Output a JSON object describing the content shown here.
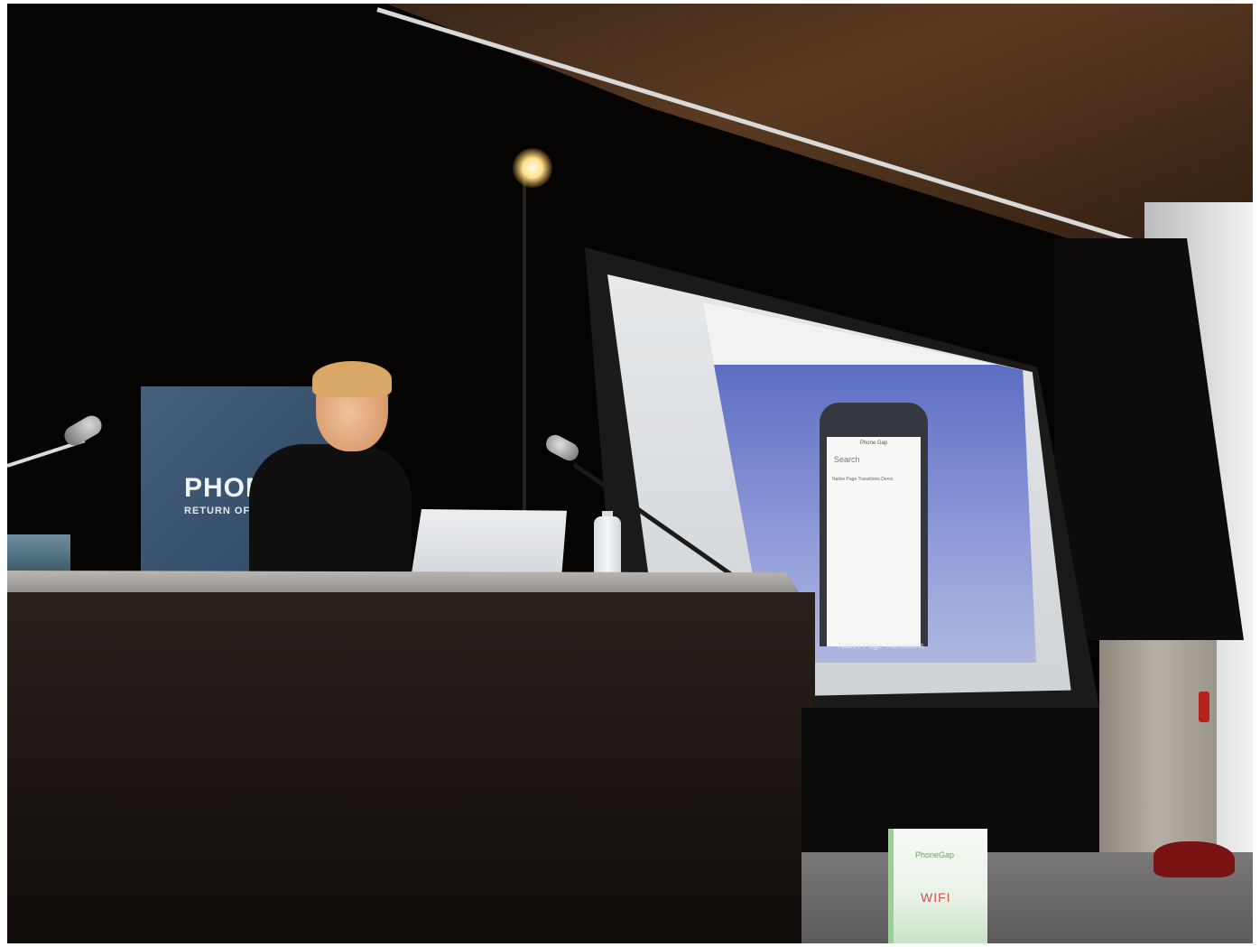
{
  "banner": {
    "title": "PHOM",
    "subtitle": "RETURN OF"
  },
  "slide": {
    "phone_status": "Phone Gap",
    "phone_back": "Search",
    "phone_body": "Native Page Transitions Demo",
    "caption": "Native Page Transitions"
  },
  "wifi_sign": {
    "brand": "PhoneGap",
    "label": "WIFI"
  },
  "colors": {
    "banner": "#3a5470",
    "slide_background": "#6a78c8",
    "table_cloth": "#1f1813",
    "sign_accent": "#9ccf98"
  }
}
